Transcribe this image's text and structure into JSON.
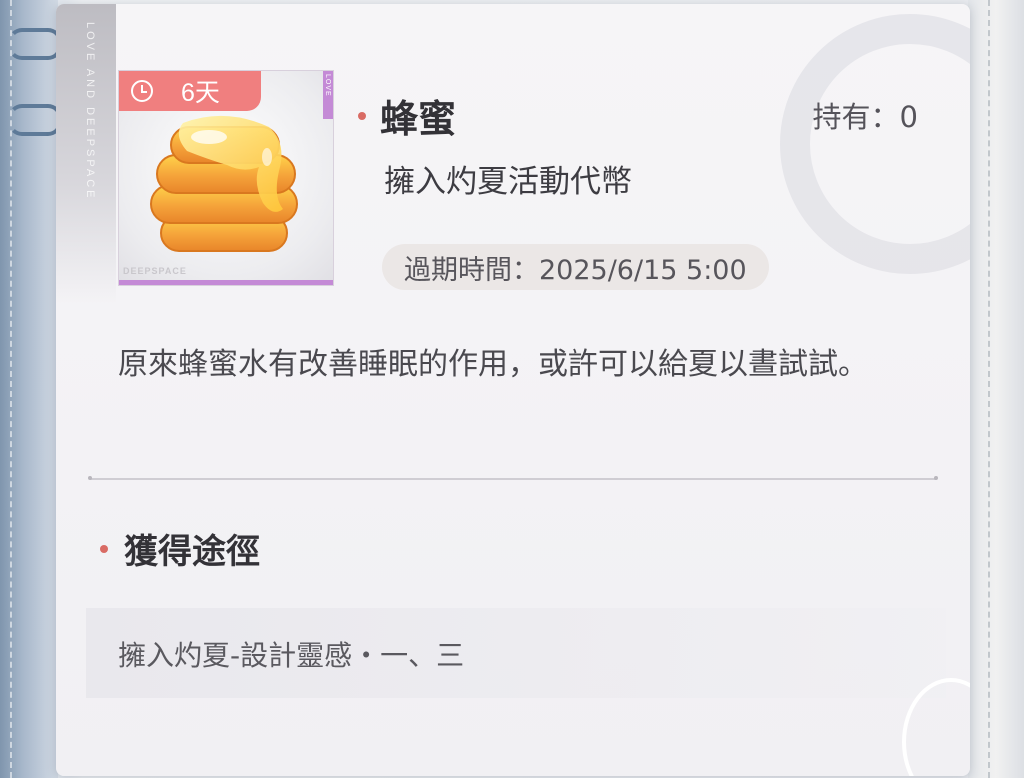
{
  "colors": {
    "accent_red": "#d96b64",
    "timer_bg": "#f07f7f",
    "rarity_purple": "#c48ad6"
  },
  "item": {
    "name": "蜂蜜",
    "owned_text": "持有：0",
    "category": "擁入灼夏活動代幣",
    "expiry_text": "過期時間：2025/6/15 5:00",
    "timer_text": "6天",
    "thumb_brand": "DEEPSPACE",
    "thumb_tag": "LOVE",
    "icon": "honey-icon",
    "description": "原來蜂蜜水有改善睡眠的作用，或許可以給夏以晝試試。"
  },
  "brand_vertical": "LOVE AND DEEPSPACE",
  "sources": {
    "title": "獲得途徑",
    "items": [
      "擁入灼夏-設計靈感・一、三"
    ]
  }
}
